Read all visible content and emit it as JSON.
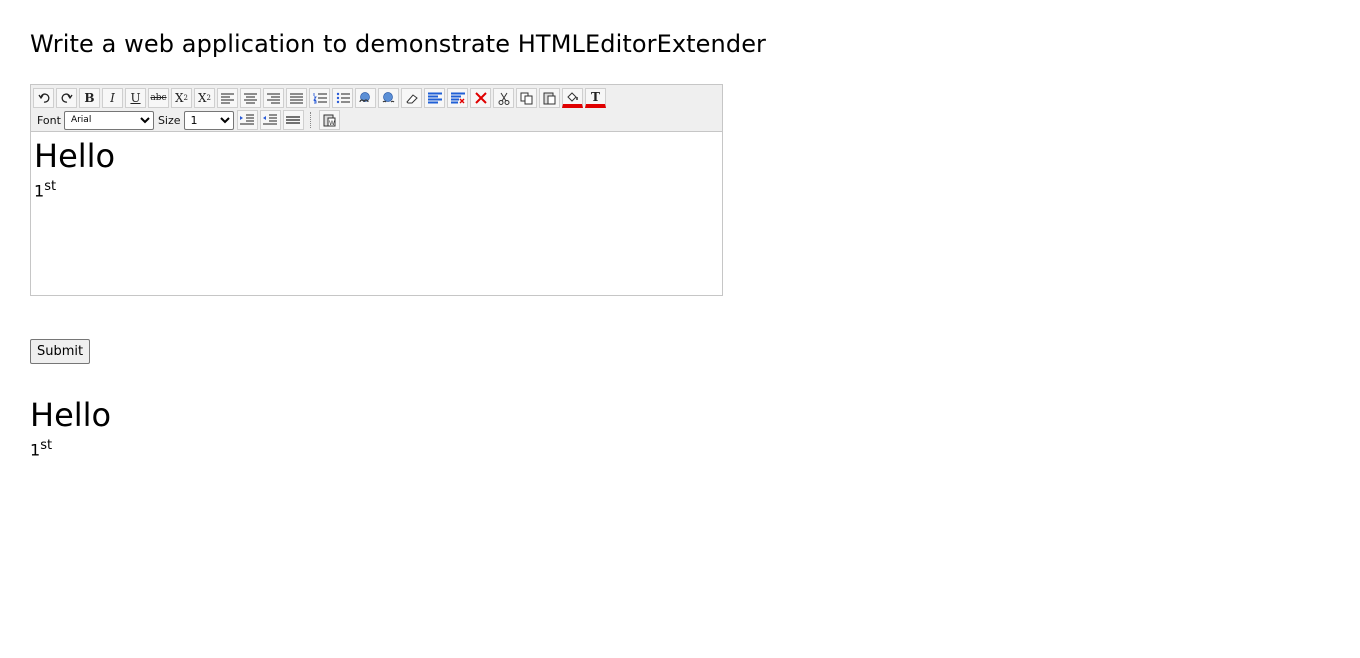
{
  "page": {
    "title": "Write a web application to demonstrate HTMLEditorExtender"
  },
  "toolbar": {
    "font_label": "Font",
    "font_value": "Arial",
    "size_label": "Size",
    "size_value": "1",
    "buttons_row1": [
      "undo-icon",
      "redo-icon",
      "bold-icon",
      "italic-icon",
      "underline-icon",
      "strikethrough-icon",
      "subscript-icon",
      "superscript-icon",
      "align-left-icon",
      "align-center-icon",
      "align-right-icon",
      "justify-icon",
      "ordered-list-icon",
      "bulleted-list-icon",
      "create-link-icon",
      "unlink-icon",
      "eraser-icon",
      "select-all-icon",
      "unselect-icon",
      "delete-icon",
      "cut-icon",
      "copy-icon",
      "paste-icon",
      "background-color-icon",
      "fore-color-icon"
    ],
    "buttons_row2": [
      "indent-icon",
      "outdent-icon",
      "horizontal-rule-icon",
      "paste-word-icon"
    ],
    "accent_color": "#e00000"
  },
  "editor": {
    "heading": "Hello",
    "ordinal_base": "1",
    "ordinal_sup": "st"
  },
  "submit": {
    "label": "Submit"
  },
  "output": {
    "heading": "Hello",
    "ordinal_base": "1",
    "ordinal_sup": "st"
  }
}
